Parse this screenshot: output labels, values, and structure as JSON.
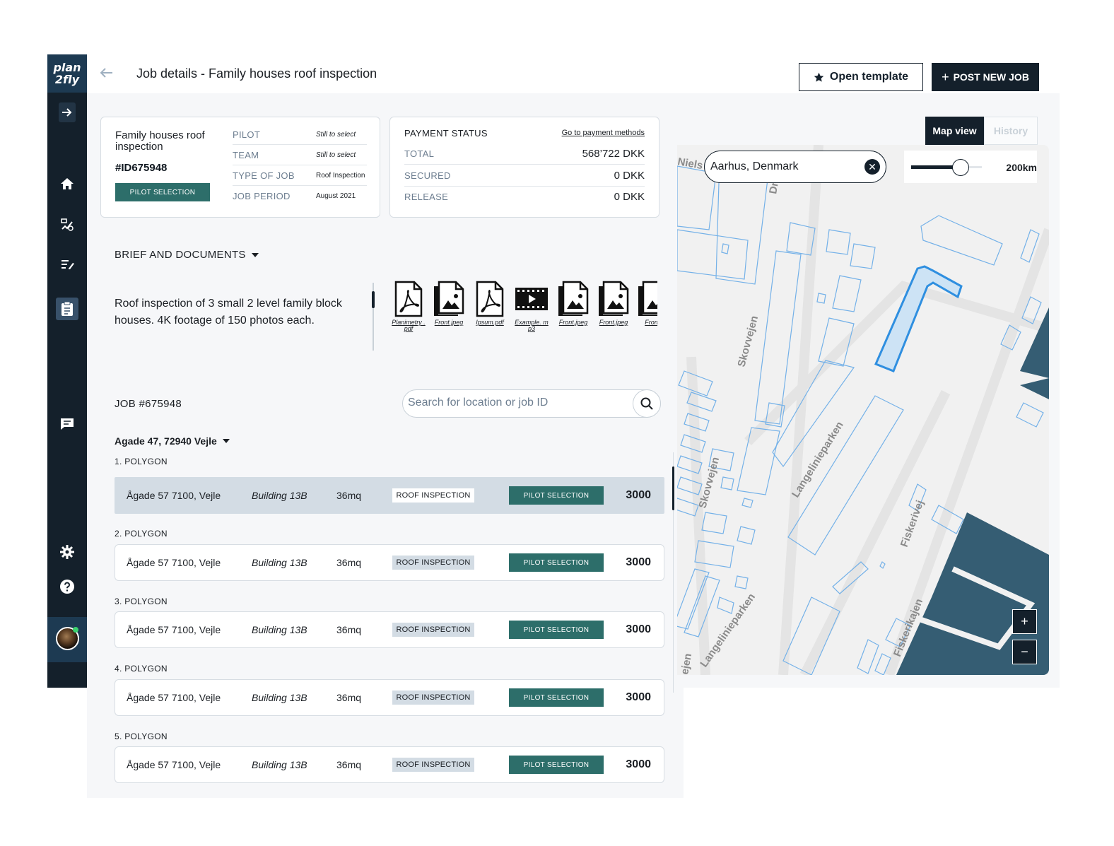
{
  "brand": {
    "logo_line1": "plan",
    "logo_line2": "2fly"
  },
  "header": {
    "title": "Job details - Family houses roof inspection",
    "open_template_label": "Open template",
    "post_job_label": "POST NEW JOB"
  },
  "job_card": {
    "name": "Family houses roof inspection",
    "id": "#ID675948",
    "status_button": "PILOT SELECTION",
    "rows": [
      {
        "key": "PILOT",
        "value": "Still to select"
      },
      {
        "key": "TEAM",
        "value": "Still to select"
      },
      {
        "key": "TYPE OF JOB",
        "value": "Roof Inspection"
      },
      {
        "key": "JOB PERIOD",
        "value": "August 2021"
      }
    ]
  },
  "payment": {
    "title": "PAYMENT STATUS",
    "link": "Go to payment methods",
    "rows": [
      {
        "key": "TOTAL",
        "value": "568’722 DKK"
      },
      {
        "key": "SECURED",
        "value": "0 DKK"
      },
      {
        "key": "RELEASE",
        "value": "0 DKK"
      }
    ]
  },
  "brief": {
    "title": "BRIEF AND DOCUMENTS",
    "text": "Roof inspection of 3 small 2 level family block houses. 4K footage of 150 photos each.",
    "documents": [
      {
        "label": "Planimetry .pdf",
        "icon": "pdf-icon"
      },
      {
        "label": "Front.jpeg",
        "icon": "image-icon"
      },
      {
        "label": "Ipsum.pdf",
        "icon": "pdf-icon"
      },
      {
        "label": "Example. mp3",
        "icon": "video-icon"
      },
      {
        "label": "Front.jpeg",
        "icon": "image-icon"
      },
      {
        "label": "Front.jpeg",
        "icon": "image-icon"
      },
      {
        "label": "Front.",
        "icon": "image-icon"
      }
    ]
  },
  "job_section": {
    "title": "JOB #675948",
    "search_placeholder": "Search for location or job ID",
    "address": "Agade 47, 72940 Vejle"
  },
  "polygons": [
    {
      "label": "1. POLYGON",
      "address": "Ågade 57 7100, Vejle",
      "building": "Building 13B",
      "area": "36mq",
      "type": "ROOF INSPECTION",
      "status": "PILOT SELECTION",
      "price": "3000",
      "selected": true
    },
    {
      "label": "2. POLYGON",
      "address": "Ågade 57 7100, Vejle",
      "building": "Building 13B",
      "area": "36mq",
      "type": "ROOF INSPECTION",
      "status": "PILOT SELECTION",
      "price": "3000",
      "selected": false
    },
    {
      "label": "3. POLYGON",
      "address": "Ågade 57 7100, Vejle",
      "building": "Building 13B",
      "area": "36mq",
      "type": "ROOF INSPECTION",
      "status": "PILOT SELECTION",
      "price": "3000",
      "selected": false
    },
    {
      "label": "4. POLYGON",
      "address": "Ågade 57 7100, Vejle",
      "building": "Building 13B",
      "area": "36mq",
      "type": "ROOF INSPECTION",
      "status": "PILOT SELECTION",
      "price": "3000",
      "selected": false
    },
    {
      "label": "5. POLYGON",
      "address": "Ågade 57 7100, Vejle",
      "building": "Building 13B",
      "area": "36mq",
      "type": "ROOF INSPECTION",
      "status": "PILOT SELECTION",
      "price": "3000",
      "selected": false
    }
  ],
  "map": {
    "tab_map": "Map view",
    "tab_history": "History",
    "location": "Aarhus, Denmark",
    "radius_label": "200km",
    "radius_fraction": 0.7,
    "zoom_in": "+",
    "zoom_out": "−",
    "street_labels": [
      "Niels",
      "Dr",
      "Skovvejen",
      "Langelinieparken",
      "Skovvejen",
      "Fiskerivej",
      "Langelinieparken",
      "Fiskerikajen",
      "ejen"
    ]
  },
  "colors": {
    "sidebar": "#14202b",
    "accent_teal": "#2d6e6a",
    "map_outline": "#6aaee6",
    "map_water": "#355d73"
  }
}
